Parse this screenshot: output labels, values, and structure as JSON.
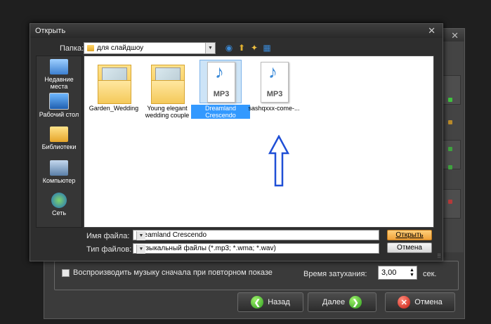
{
  "background_window": {
    "repeat_checkbox_label": "Воспроизводить музыку сначала при повторном показе",
    "fade_label": "Время затухания:",
    "fade_value": "3,00",
    "fade_unit": "сек.",
    "back_button": "Назад",
    "next_button": "Далее",
    "cancel_button": "Отмена"
  },
  "dialog": {
    "title": "Открыть",
    "folder_label": "Папка:",
    "folder_value": "для слайдшоу",
    "places": [
      {
        "label": "Недавние места",
        "icon": "recent-places-icon"
      },
      {
        "label": "Рабочий стол",
        "icon": "desktop-icon"
      },
      {
        "label": "Библиотеки",
        "icon": "libraries-icon"
      },
      {
        "label": "Компьютер",
        "icon": "computer-icon"
      },
      {
        "label": "Сеть",
        "icon": "network-icon"
      }
    ],
    "files": [
      {
        "name": "Garden_Wedding",
        "type": "folder"
      },
      {
        "name": "Young elegant wedding couple",
        "type": "folder"
      },
      {
        "name": "Dreamland Crescendo",
        "type": "mp3",
        "selected": true,
        "badge": "MP3"
      },
      {
        "name": "sashqxxx-come-...",
        "type": "mp3",
        "badge": "MP3"
      }
    ],
    "filename_label": "Имя файла:",
    "filename_value": "Dreamland Crescendo",
    "filetype_label": "Тип файлов:",
    "filetype_value": "Музыкальный файлы (*.mp3; *.wma; *.wav)",
    "open_button": "Открыть",
    "cancel_button": "Отмена"
  },
  "colors": {
    "accent_open": "#f0a23a",
    "selection": "#3399ff",
    "annotation_arrow": "#1f4fd6"
  }
}
